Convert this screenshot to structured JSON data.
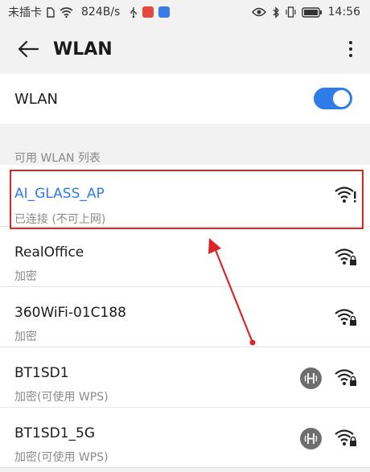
{
  "status_bar": {
    "carrier": "未插卡",
    "speed": "824B/s",
    "time": "14:56",
    "colors": {
      "app1": "#e8473f",
      "app2": "#3b7be8"
    }
  },
  "app_bar": {
    "title": "WLAN",
    "back_icon": "arrow-left-icon",
    "more_icon": "more-vertical-icon"
  },
  "wlan_toggle": {
    "label": "WLAN",
    "enabled": true,
    "accent": "#2e7ce8"
  },
  "section": {
    "title": "可用 WLAN 列表"
  },
  "networks": [
    {
      "name": "AI_GLASS_AP",
      "status": "已连接 (不可上网)",
      "connected": true,
      "wps": false,
      "signal_icon": "wifi-alert-icon"
    },
    {
      "name": "RealOffice",
      "status": "加密",
      "connected": false,
      "wps": false,
      "signal_icon": "wifi-lock-icon"
    },
    {
      "name": "360WiFi-01C188",
      "status": "加密",
      "connected": false,
      "wps": false,
      "signal_icon": "wifi-lock-icon"
    },
    {
      "name": "BT1SD1",
      "status": "加密(可使用 WPS)",
      "connected": false,
      "wps": true,
      "signal_icon": "wifi-lock-icon"
    },
    {
      "name": "BT1SD1_5G",
      "status": "加密(可使用 WPS)",
      "connected": false,
      "wps": true,
      "signal_icon": "wifi-lock-icon"
    }
  ],
  "annotation": {
    "color": "#d9262b"
  }
}
